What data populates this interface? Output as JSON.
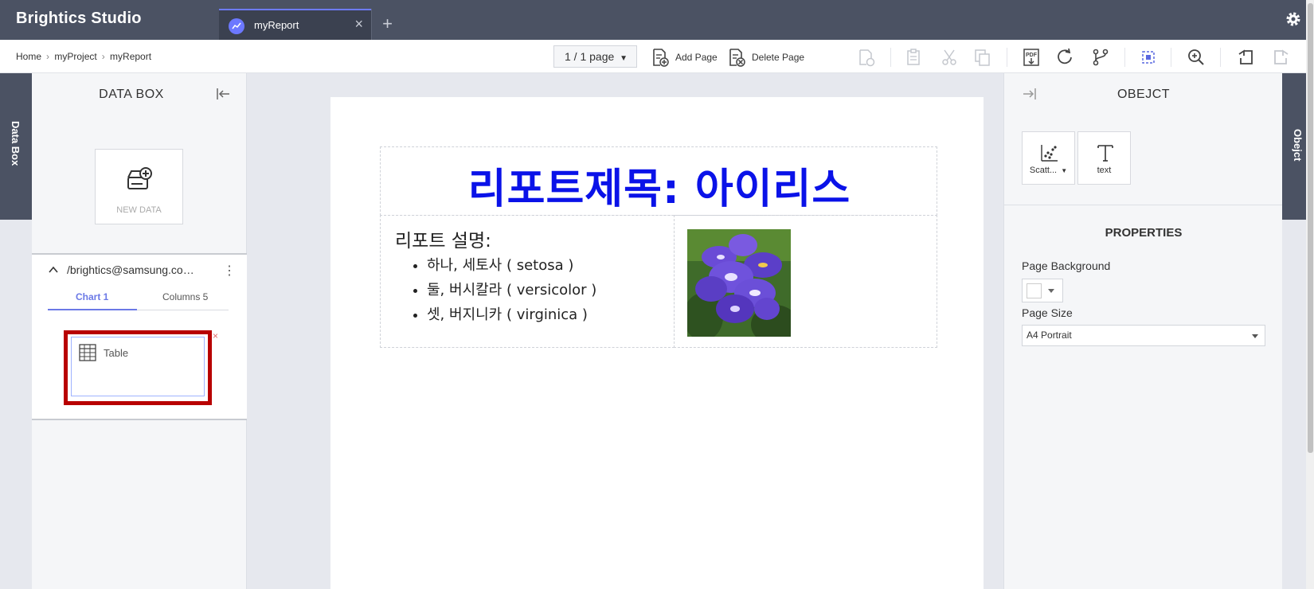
{
  "app": {
    "title": "Brightics Studio"
  },
  "tabs": [
    {
      "label": "myReport"
    }
  ],
  "breadcrumb": [
    "Home",
    "myProject",
    "myReport"
  ],
  "toolbar": {
    "page_selector": "1 / 1 page",
    "add_page": "Add Page",
    "delete_page": "Delete Page"
  },
  "side_strips": {
    "left": "Data Box",
    "right": "Obejct"
  },
  "databox": {
    "title": "DATA BOX",
    "new_data_label": "NEW DATA",
    "source": {
      "path": "/brightics@samsung.com/...",
      "tabs": [
        {
          "label": "Chart 1"
        },
        {
          "label": "Columns 5"
        }
      ],
      "charts": [
        {
          "label": "Table",
          "icon": "table-icon"
        }
      ]
    }
  },
  "report": {
    "title": "리포트제목: 아이리스",
    "description_title": "리포트 설명:",
    "items": [
      "하나, 세토사 ( setosa )",
      "둘, 버시칼라 ( versicolor )",
      "셋, 버지니카 ( virginica )"
    ],
    "title_color": "#0a12e8"
  },
  "object_panel": {
    "title": "OBEJCT",
    "objects": [
      {
        "label": "Scatt...",
        "icon": "scatter-chart-icon"
      },
      {
        "label": "text",
        "icon": "text-icon"
      }
    ],
    "properties_title": "PROPERTIES",
    "page_background_label": "Page Background",
    "page_size_label": "Page Size",
    "page_size_value": "A4 Portrait"
  },
  "colors": {
    "header": "#4b5263",
    "accent": "#6b79e6",
    "highlight": "#b80000"
  }
}
